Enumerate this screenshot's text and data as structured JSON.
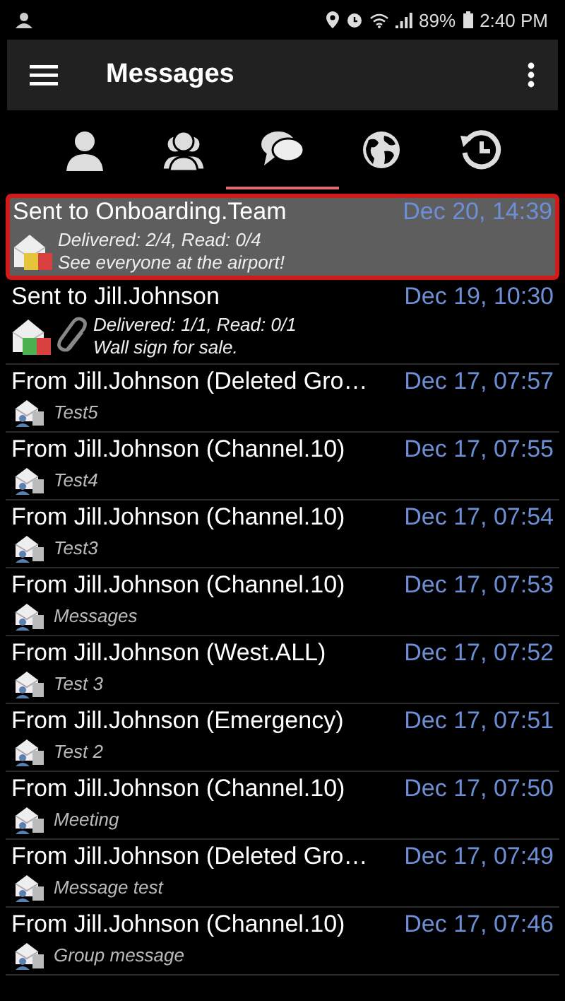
{
  "status_bar": {
    "battery": "89%",
    "time": "2:40 PM"
  },
  "app_bar": {
    "title": "Messages"
  },
  "tabs": [
    {
      "kind": "person",
      "selected": false
    },
    {
      "kind": "group",
      "selected": false
    },
    {
      "kind": "chat",
      "selected": true
    },
    {
      "kind": "globe",
      "selected": false
    },
    {
      "kind": "history",
      "selected": false
    }
  ],
  "messages": [
    {
      "kind": "sent",
      "title": "Sent to Onboarding.Team",
      "date": "Dec 20, 14:39",
      "status": "Delivered: 2/4, Read: 0/4",
      "text": "See everyone at the airport!",
      "color": "#e6c53a",
      "attachment": false,
      "selected": true
    },
    {
      "kind": "sent",
      "title": "Sent to Jill.Johnson",
      "date": "Dec 19, 10:30",
      "status": "Delivered: 1/1, Read: 0/1",
      "text": "Wall sign for sale.",
      "color": "#4caf50",
      "attachment": true,
      "selected": false
    },
    {
      "kind": "received",
      "title": "From Jill.Johnson (Deleted Gro…",
      "date": "Dec 17, 07:57",
      "text": "Test5",
      "selected": false
    },
    {
      "kind": "received",
      "title": "From Jill.Johnson (Channel.10)",
      "date": "Dec 17, 07:55",
      "text": "Test4",
      "selected": false
    },
    {
      "kind": "received",
      "title": "From Jill.Johnson (Channel.10)",
      "date": "Dec 17, 07:54",
      "text": "Test3",
      "selected": false
    },
    {
      "kind": "received",
      "title": "From Jill.Johnson (Channel.10)",
      "date": "Dec 17, 07:53",
      "text": "Messages",
      "selected": false
    },
    {
      "kind": "received",
      "title": "From Jill.Johnson (West.ALL)",
      "date": "Dec 17, 07:52",
      "text": "Test 3",
      "selected": false
    },
    {
      "kind": "received",
      "title": "From Jill.Johnson (Emergency)",
      "date": "Dec 17, 07:51",
      "text": "Test 2",
      "selected": false
    },
    {
      "kind": "received",
      "title": "From Jill.Johnson (Channel.10)",
      "date": "Dec 17, 07:50",
      "text": "Meeting",
      "selected": false
    },
    {
      "kind": "received",
      "title": "From Jill.Johnson (Deleted Gro…",
      "date": "Dec 17, 07:49",
      "text": "Message test",
      "selected": false
    },
    {
      "kind": "received",
      "title": "From Jill.Johnson (Channel.10)",
      "date": "Dec 17, 07:46",
      "text": "Group message",
      "selected": false
    }
  ]
}
